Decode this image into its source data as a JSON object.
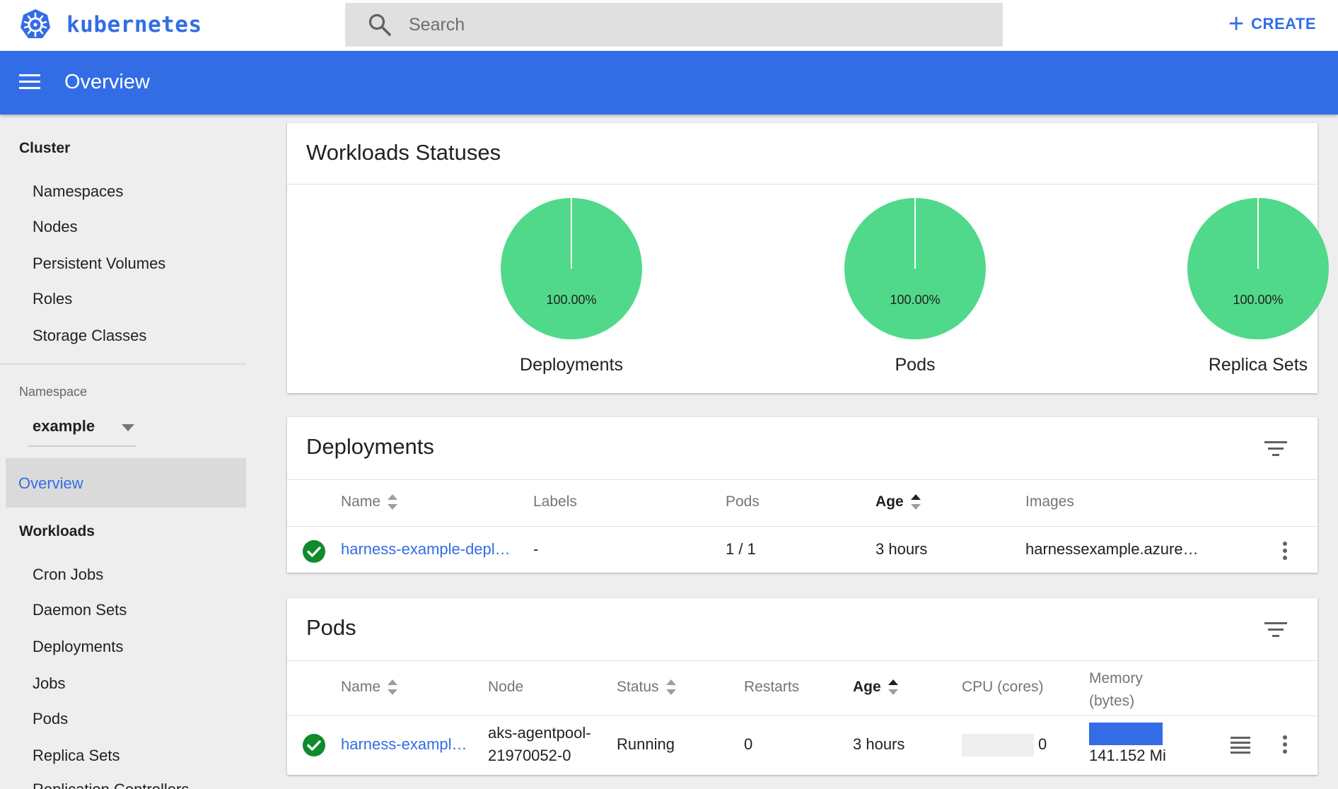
{
  "app": {
    "brand": "kubernetes",
    "search_placeholder": "Search",
    "create_label": "CREATE",
    "page_title": "Overview",
    "accent_color": "#326de6",
    "success_color": "#50d98a"
  },
  "sidebar": {
    "cluster_heading": "Cluster",
    "cluster_items": [
      "Namespaces",
      "Nodes",
      "Persistent Volumes",
      "Roles",
      "Storage Classes"
    ],
    "namespace_label": "Namespace",
    "namespace_value": "example",
    "active_item": "Overview",
    "workloads_heading": "Workloads",
    "workloads_items": [
      "Cron Jobs",
      "Daemon Sets",
      "Deployments",
      "Jobs",
      "Pods",
      "Replica Sets",
      "Replication Controllers"
    ]
  },
  "workloads_statuses": {
    "title": "Workloads Statuses",
    "charts": [
      {
        "label": "Deployments",
        "percent_text": "100.00%",
        "success_fraction": 1.0
      },
      {
        "label": "Pods",
        "percent_text": "100.00%",
        "success_fraction": 1.0
      },
      {
        "label": "Replica Sets",
        "percent_text": "100.00%",
        "success_fraction": 1.0
      }
    ]
  },
  "deployments": {
    "title": "Deployments",
    "columns": [
      "Name",
      "Labels",
      "Pods",
      "Age",
      "Images"
    ],
    "rows": [
      {
        "status": "check-icon",
        "name": "harness-example-depl…",
        "labels": "-",
        "pods": "1 / 1",
        "age": "3 hours",
        "images": "harnessexample.azure…"
      }
    ]
  },
  "pods": {
    "title": "Pods",
    "columns": [
      "Name",
      "Node",
      "Status",
      "Restarts",
      "Age",
      "CPU (cores)",
      "Memory\n(bytes)"
    ],
    "rows": [
      {
        "status": "check-icon",
        "name": "harness-exampl…",
        "node_line1": "aks-agentpool-",
        "node_line2": "21970052-0",
        "pod_status": "Running",
        "restarts": "0",
        "age": "3 hours",
        "cpu": "0",
        "memory": "141.152 Mi"
      }
    ]
  }
}
